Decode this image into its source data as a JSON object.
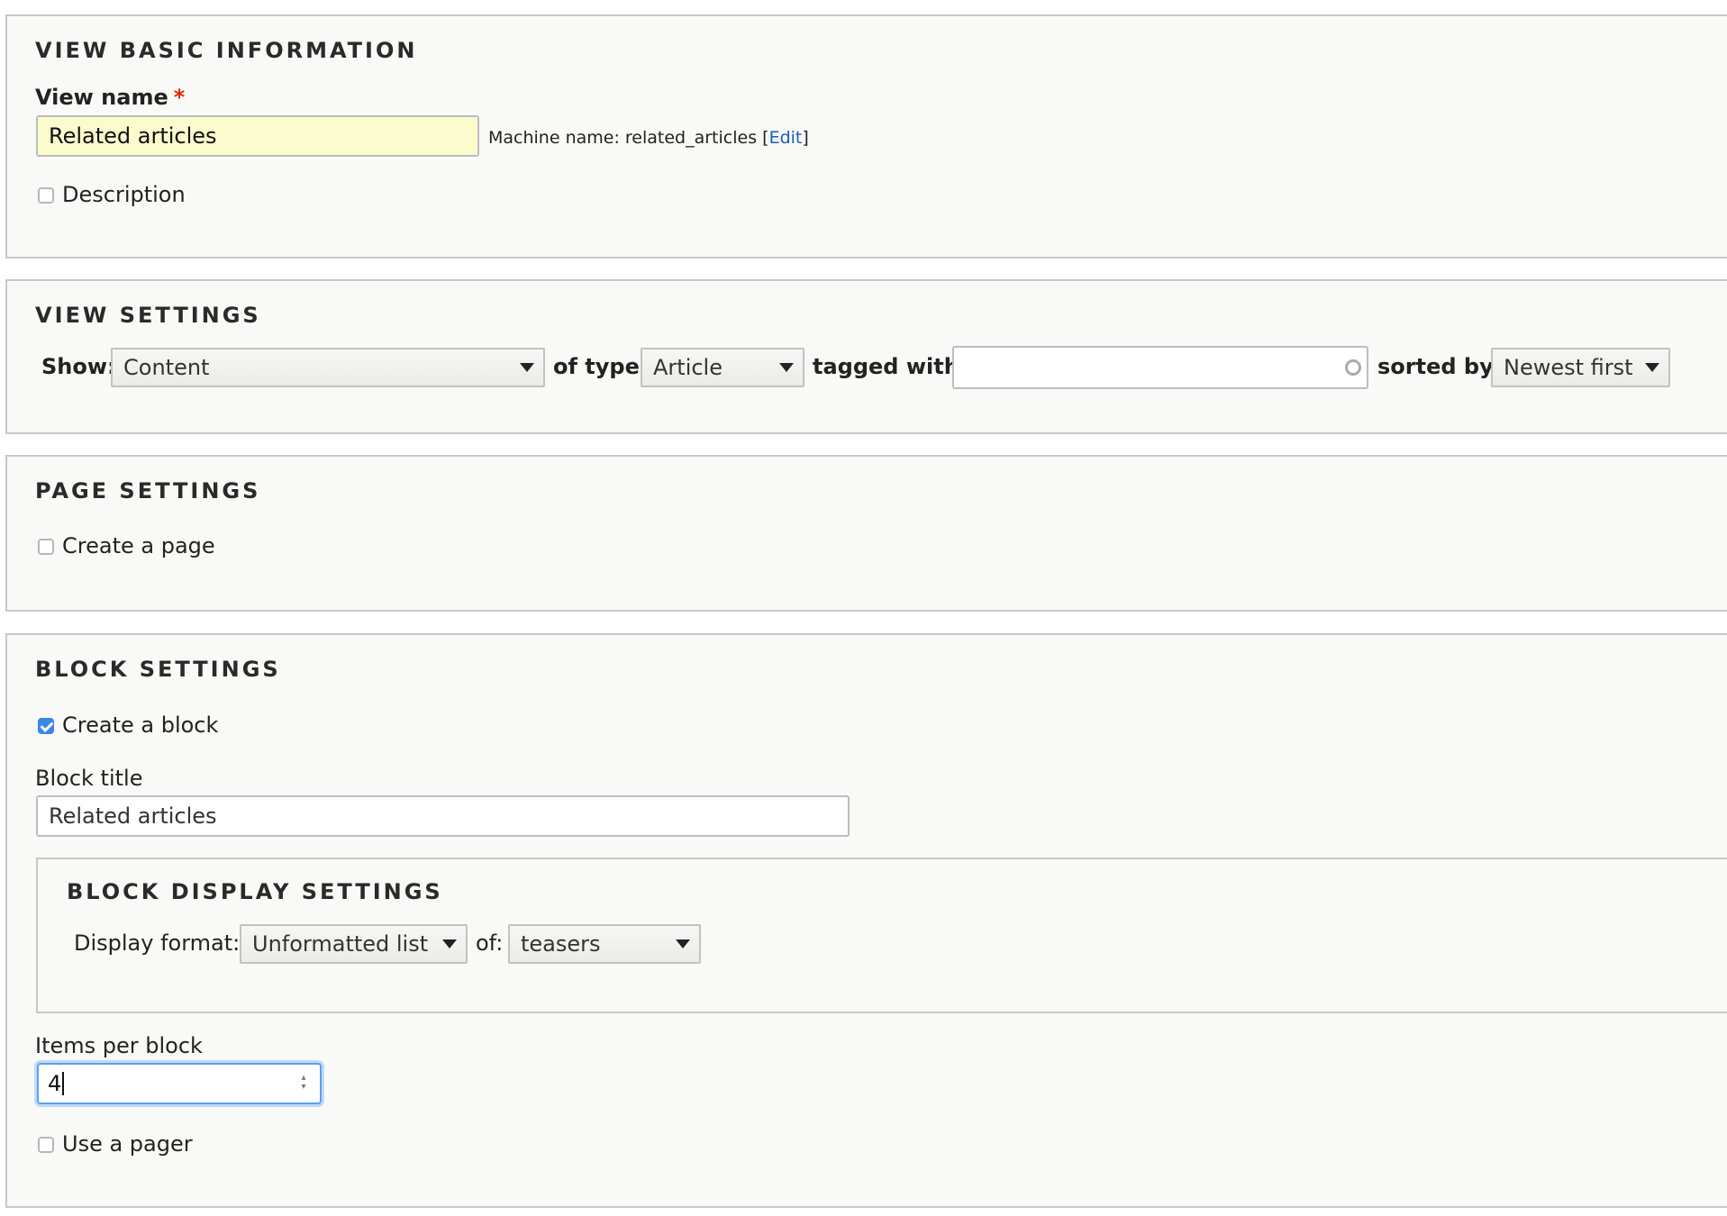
{
  "basic": {
    "legend": "VIEW BASIC INFORMATION",
    "view_name_label": "View name",
    "required_mark": "*",
    "view_name_value": "Related articles",
    "machine_name_prefix": "Machine name: related_articles ",
    "machine_edit_open": "[",
    "machine_edit_link": "Edit",
    "machine_edit_close": "]",
    "description_label": "Description"
  },
  "view_settings": {
    "legend": "VIEW SETTINGS",
    "show_label": "Show:",
    "show_value": "Content",
    "type_label": "of type:",
    "type_value": "Article",
    "tagged_label": "tagged with:",
    "tagged_value": "",
    "sorted_label": "sorted by:",
    "sorted_value": "Newest first"
  },
  "page_settings": {
    "legend": "PAGE SETTINGS",
    "create_page_label": "Create a page",
    "create_page_checked": false
  },
  "block_settings": {
    "legend": "BLOCK SETTINGS",
    "create_block_label": "Create a block",
    "create_block_checked": true,
    "block_title_label": "Block title",
    "block_title_value": "Related articles",
    "display": {
      "legend": "BLOCK DISPLAY SETTINGS",
      "format_label": "Display format:",
      "format_value": "Unformatted list",
      "of_label": "of:",
      "of_value": "teasers"
    },
    "items_label": "Items per block",
    "items_value": "4",
    "pager_label": "Use a pager",
    "pager_checked": false
  },
  "colors": {
    "accent": "#3b86e8",
    "required": "#e32700",
    "link": "#1a5fb4",
    "highlight_input": "#fbfbcd"
  }
}
